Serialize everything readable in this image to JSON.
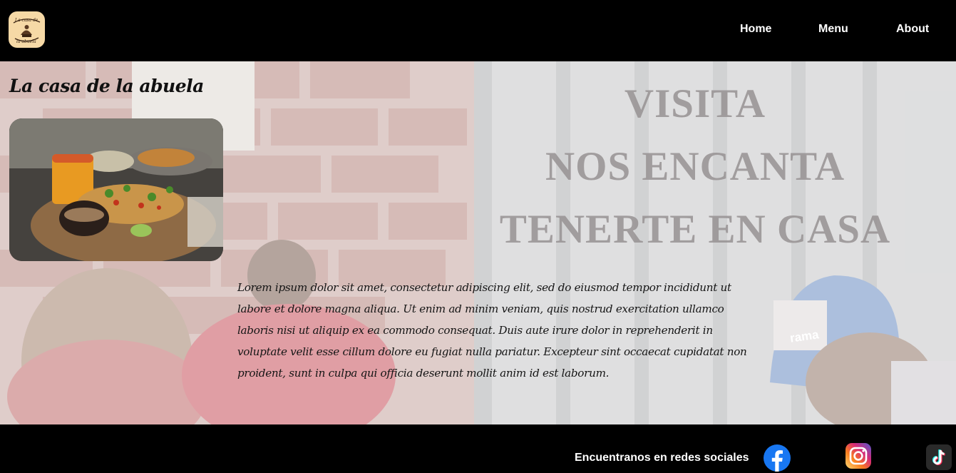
{
  "header": {
    "logo_text": "La casa de la abuela",
    "nav": [
      {
        "label": "Home"
      },
      {
        "label": "Menu"
      },
      {
        "label": "About"
      }
    ]
  },
  "hero": {
    "title": "La casa de la abuela",
    "slogan": [
      "VISITA",
      "NOS ENCANTA",
      "TENERTE EN CASA"
    ],
    "body": "Lorem ipsum dolor sit amet, consectetur adipiscing elit, sed do eiusmod tempor incididunt ut labore et dolore magna aliqua. Ut enim ad minim veniam, quis nostrud exercitation ullamco laboris nisi ut aliquip ex ea commodo consequat. Duis aute irure dolor in reprehenderit in voluptate velit esse cillum dolore eu fugiat nulla pariatur. Excepteur sint occaecat cupidatat non proident, sunt in culpa qui officia deserunt mollit anim id est laborum.",
    "cap_text": "rama"
  },
  "footer": {
    "social_text": "Encuentranos en redes sociales",
    "icons": [
      "facebook-icon",
      "instagram-icon",
      "tiktok-icon"
    ]
  },
  "colors": {
    "bar": "#000000",
    "facebook": "#1877f2",
    "instagram_from": "#feda75",
    "instagram_to": "#d62976"
  }
}
